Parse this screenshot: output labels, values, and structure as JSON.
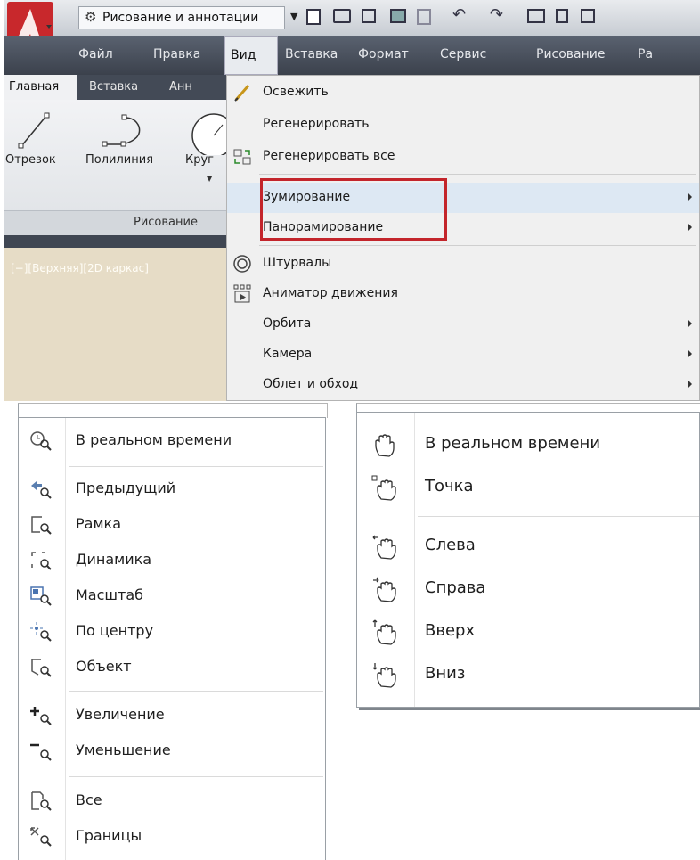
{
  "app": {
    "workspace": "Рисование и аннотации",
    "menu": [
      "Файл",
      "Правка",
      "Вид",
      "Вставка",
      "Формат",
      "Сервис",
      "Рисование",
      "Ра"
    ],
    "ribbon_tabs": [
      "Главная",
      "Вставка",
      "Анн"
    ],
    "tools": [
      "Отрезок",
      "Полилиния",
      "Круг"
    ],
    "panel_title": "Рисование",
    "viewport_label": "[−][Верхняя][2D каркас]"
  },
  "view_menu": {
    "items": [
      {
        "label": "Освежить",
        "icon": "pencil-icon",
        "submenu": false
      },
      {
        "label": "Регенерировать",
        "icon": "",
        "submenu": false
      },
      {
        "label": "Регенерировать все",
        "icon": "regen-all-icon",
        "submenu": false
      },
      {
        "label": "Зумирование",
        "icon": "",
        "submenu": true
      },
      {
        "label": "Панорамирование",
        "icon": "",
        "submenu": true
      },
      {
        "label": "Штурвалы",
        "icon": "steering-wheel-icon",
        "submenu": false
      },
      {
        "label": "Аниматор движения",
        "icon": "animator-icon",
        "submenu": false
      },
      {
        "label": "Орбита",
        "icon": "",
        "submenu": true
      },
      {
        "label": "Камера",
        "icon": "",
        "submenu": true
      },
      {
        "label": "Облет и обход",
        "icon": "",
        "submenu": true
      }
    ]
  },
  "zoom_menu": {
    "items": [
      "В реальном времени",
      "Предыдущий",
      "Рамка",
      "Динамика",
      "Масштаб",
      "По центру",
      "Объект",
      "Увеличение",
      "Уменьшение",
      "Все",
      "Границы"
    ]
  },
  "pan_menu": {
    "items": [
      "В реальном времени",
      "Точка",
      "Слева",
      "Справа",
      "Вверх",
      "Вниз"
    ]
  },
  "colors": {
    "highlight_box": "#c3252b",
    "menubar": "#4a515d",
    "viewport": "#e6dcc6"
  }
}
